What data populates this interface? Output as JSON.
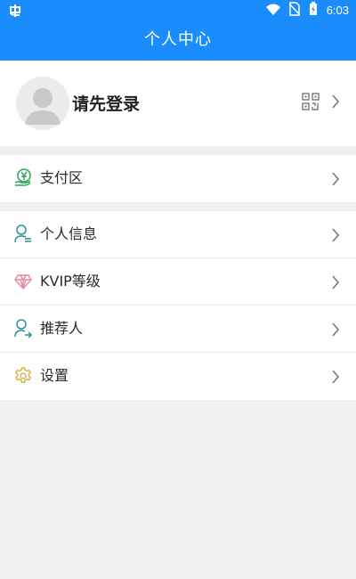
{
  "status_bar": {
    "time": "6:03"
  },
  "header": {
    "title": "个人中心"
  },
  "profile": {
    "login_prompt": "请先登录"
  },
  "payment_section": {
    "items": [
      {
        "label": "支付区",
        "icon": "yuan-hand-icon"
      }
    ]
  },
  "menu_section": {
    "items": [
      {
        "label": "个人信息",
        "icon": "user-info-icon"
      },
      {
        "label": "KVIP等级",
        "icon": "diamond-icon"
      },
      {
        "label": "推荐人",
        "icon": "referrer-icon"
      },
      {
        "label": "设置",
        "icon": "gear-icon"
      }
    ]
  },
  "colors": {
    "primary": "#1a8cfb",
    "payment_icon": "#27a85a",
    "user_icon": "#2a8f99",
    "diamond_icon": "#e88a9a",
    "gear_icon": "#d9b24a"
  }
}
